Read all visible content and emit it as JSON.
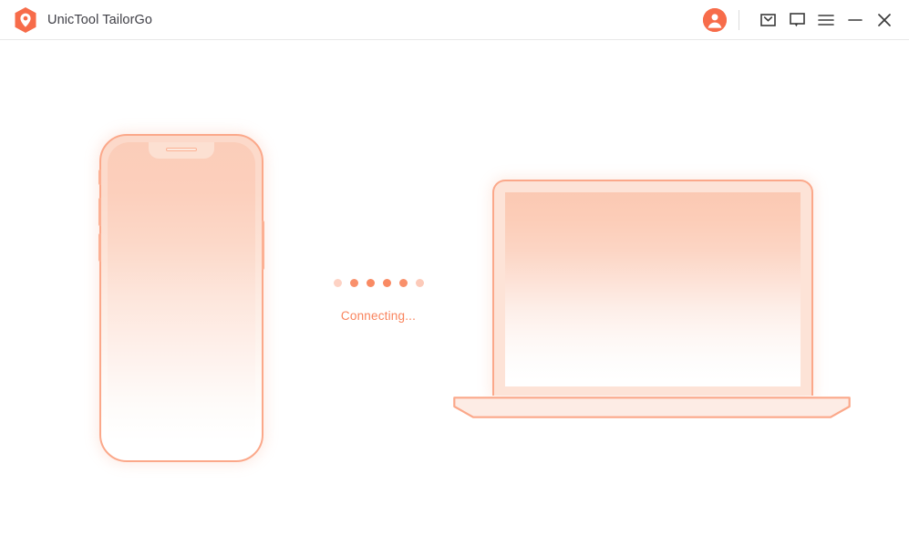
{
  "window": {
    "title": "UnicTool TailorGo",
    "logo_icon": "location-pin-shield-logo",
    "controls": [
      {
        "name": "account-avatar",
        "icon": "user-avatar-icon",
        "label": "Account"
      },
      {
        "name": "mail",
        "icon": "envelope-icon",
        "label": "Mail"
      },
      {
        "name": "feedback",
        "icon": "speech-bubble-icon",
        "label": "Feedback"
      },
      {
        "name": "menu",
        "icon": "hamburger-menu-icon",
        "label": "Menu"
      },
      {
        "name": "minimize",
        "icon": "minimize-icon",
        "label": "Minimize"
      },
      {
        "name": "close",
        "icon": "close-icon",
        "label": "Close"
      }
    ]
  },
  "stage": {
    "device_phone": {
      "icon": "smartphone-illustration",
      "label": "Phone"
    },
    "device_computer": {
      "icon": "laptop-illustration",
      "label": "Computer"
    },
    "connection": {
      "status_text": "Connecting...",
      "dot_count": 6,
      "dot_opacities": [
        0.38,
        0.95,
        1.0,
        1.0,
        0.95,
        0.45
      ]
    }
  },
  "colors": {
    "accent": "#f76c4a",
    "status_text": "#f9835c",
    "device_outline": "#fba88a",
    "device_fill_top": "#fbc9b3",
    "titlebar_border": "#e8e8e8",
    "icon_dark": "#3f3f46",
    "background": "#ffffff"
  }
}
